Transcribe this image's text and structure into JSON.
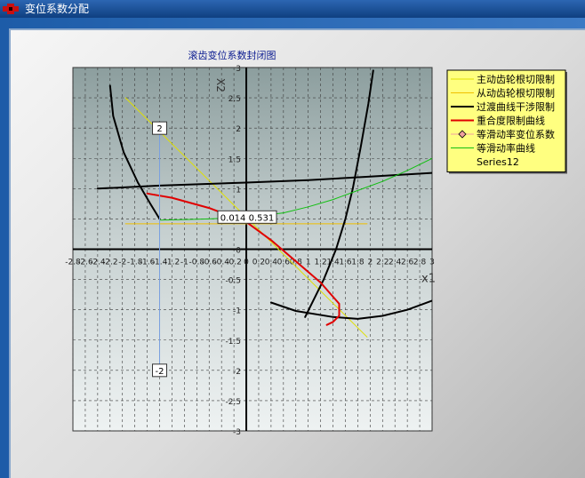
{
  "window": {
    "title": "变位系数分配",
    "icon": "app-window-icon"
  },
  "chart_data": {
    "type": "line",
    "title": "滚齿变位系数封闭图",
    "xlabel": "x1",
    "ylabel": "X2",
    "xlim": [
      -2.8,
      3
    ],
    "ylim": [
      -3,
      3
    ],
    "x_ticks": [
      "-2.8",
      "-2.6",
      "-2.4",
      "-2.2",
      "-2",
      "-1.8",
      "-1.6",
      "-1.4",
      "-1.2",
      "-1",
      "-0.8",
      "-0.6",
      "-0.4",
      "-0.2",
      "0",
      "0.2",
      "0.4",
      "0.6",
      "0.8",
      "1",
      "1.2",
      "1.4",
      "1.6",
      "1.8",
      "2",
      "2.2",
      "2.4",
      "2.6",
      "2.8",
      "3"
    ],
    "y_ticks": [
      "3",
      "2.5",
      "2",
      "1.5",
      "1",
      "0.5",
      "0",
      "-0.5",
      "-1",
      "-1.5",
      "-2",
      "-2.5",
      "-3"
    ],
    "grid": true,
    "legend_position": "top-right",
    "background_color": "#8ca0a0",
    "series": [
      {
        "name": "主动齿轮根切限制",
        "color": "#e0e000",
        "width": 1,
        "points": [
          [
            -1.95,
            2.5
          ],
          [
            1.95,
            -1.45
          ]
        ]
      },
      {
        "name": "从动齿轮根切限制",
        "color": "#f0c000",
        "width": 1,
        "points": [
          [
            -1.95,
            0.42
          ],
          [
            1.95,
            0.42
          ]
        ]
      },
      {
        "name": "过渡曲线干涉限制",
        "color": "#000000",
        "width": 2,
        "segments": [
          [
            [
              -2.2,
              2.7
            ],
            [
              -2.15,
              2.2
            ],
            [
              -1.98,
              1.6
            ],
            [
              -1.75,
              1.1
            ],
            [
              -1.55,
              0.75
            ],
            [
              -1.4,
              0.5
            ]
          ],
          [
            [
              -2.4,
              1.0
            ],
            [
              -1.4,
              1.05
            ],
            [
              0,
              1.1
            ],
            [
              1.0,
              1.14
            ],
            [
              2.0,
              1.2
            ],
            [
              3.0,
              1.26
            ]
          ],
          [
            [
              0.95,
              -1.12
            ],
            [
              1.25,
              -0.5
            ],
            [
              1.45,
              0
            ],
            [
              1.6,
              0.5
            ],
            [
              1.72,
              1.0
            ],
            [
              1.85,
              1.7
            ],
            [
              1.97,
              2.4
            ],
            [
              2.05,
              2.95
            ]
          ],
          [
            [
              0.4,
              -0.88
            ],
            [
              0.8,
              -1.02
            ],
            [
              1.4,
              -1.12
            ],
            [
              1.8,
              -1.15
            ],
            [
              2.2,
              -1.1
            ],
            [
              2.6,
              -1.0
            ],
            [
              3.0,
              -0.85
            ]
          ]
        ]
      },
      {
        "name": "重合度限制曲线",
        "color": "#e00000",
        "width": 2,
        "points": [
          [
            -1.6,
            0.92
          ],
          [
            -1.2,
            0.85
          ],
          [
            -0.6,
            0.68
          ],
          [
            0,
            0.45
          ],
          [
            0.4,
            0.15
          ],
          [
            0.8,
            -0.2
          ],
          [
            1.2,
            -0.55
          ],
          [
            1.5,
            -0.9
          ],
          [
            1.5,
            -1.1
          ],
          [
            1.45,
            -1.15
          ],
          [
            1.4,
            -1.2
          ],
          [
            1.3,
            -1.25
          ]
        ]
      },
      {
        "name": "等滑动率变位系数",
        "color": "#f0a0a0",
        "marker": "diamond",
        "points": []
      },
      {
        "name": "等滑动率曲线",
        "color": "#10c010",
        "width": 1,
        "points": [
          [
            -1.4,
            0.48
          ],
          [
            -1.0,
            0.49
          ],
          [
            -0.6,
            0.5
          ],
          [
            -0.2,
            0.52
          ],
          [
            0.2,
            0.55
          ],
          [
            0.6,
            0.6
          ],
          [
            1.0,
            0.7
          ],
          [
            1.4,
            0.82
          ],
          [
            1.8,
            0.97
          ],
          [
            2.2,
            1.12
          ],
          [
            2.6,
            1.3
          ],
          [
            3.0,
            1.5
          ]
        ]
      },
      {
        "name": "Series12",
        "color": "#ffffff",
        "points": []
      }
    ],
    "cursor": {
      "x": -1.4,
      "label_top": "2",
      "label_bottom": "-2"
    },
    "annotation": {
      "text": "0.014 0.531",
      "x": 0.014,
      "y": 0.531
    }
  }
}
